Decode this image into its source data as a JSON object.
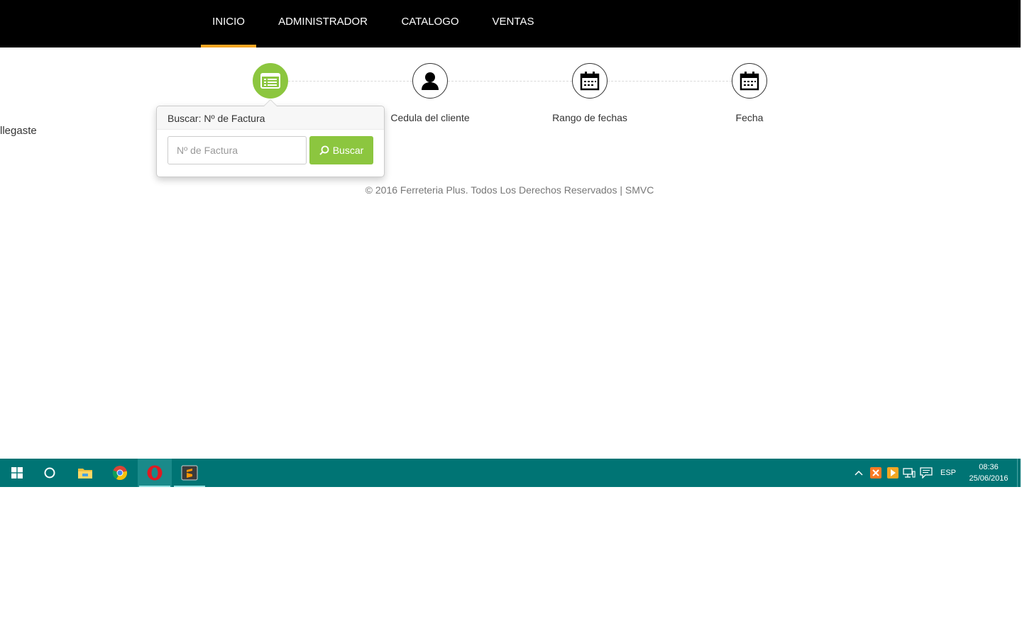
{
  "nav": {
    "items": [
      {
        "label": "INICIO",
        "active": true
      },
      {
        "label": "ADMINISTRADOR",
        "active": false
      },
      {
        "label": "CATALOGO",
        "active": false
      },
      {
        "label": "VENTAS",
        "active": false
      }
    ]
  },
  "side_text": "llegaste",
  "steps": [
    {
      "label": "",
      "icon": "invoice-list-icon",
      "active": true
    },
    {
      "label": "Cedula del cliente",
      "icon": "user-icon",
      "active": false
    },
    {
      "label": "Rango de fechas",
      "icon": "calendar-icon",
      "active": false
    },
    {
      "label": "Fecha",
      "icon": "calendar-icon",
      "active": false
    }
  ],
  "popover": {
    "title": "Buscar: Nº de Factura",
    "input_placeholder": "Nº de Factura",
    "input_value": "",
    "button_label": "Buscar"
  },
  "footer": "© 2016 Ferreteria Plus. Todos Los Derechos Reservados | SMVC",
  "taskbar": {
    "apps": [
      "start-icon",
      "cortana-icon",
      "file-explorer-icon",
      "chrome-icon",
      "opera-icon",
      "sublime-text-icon"
    ],
    "language": "ESP",
    "time": "08:36",
    "date": "25/06/2016"
  },
  "colors": {
    "accent_green": "#8cc63f",
    "nav_active_underline": "#f5a623",
    "nav_background": "#000000",
    "taskbar_background": "#007474"
  }
}
